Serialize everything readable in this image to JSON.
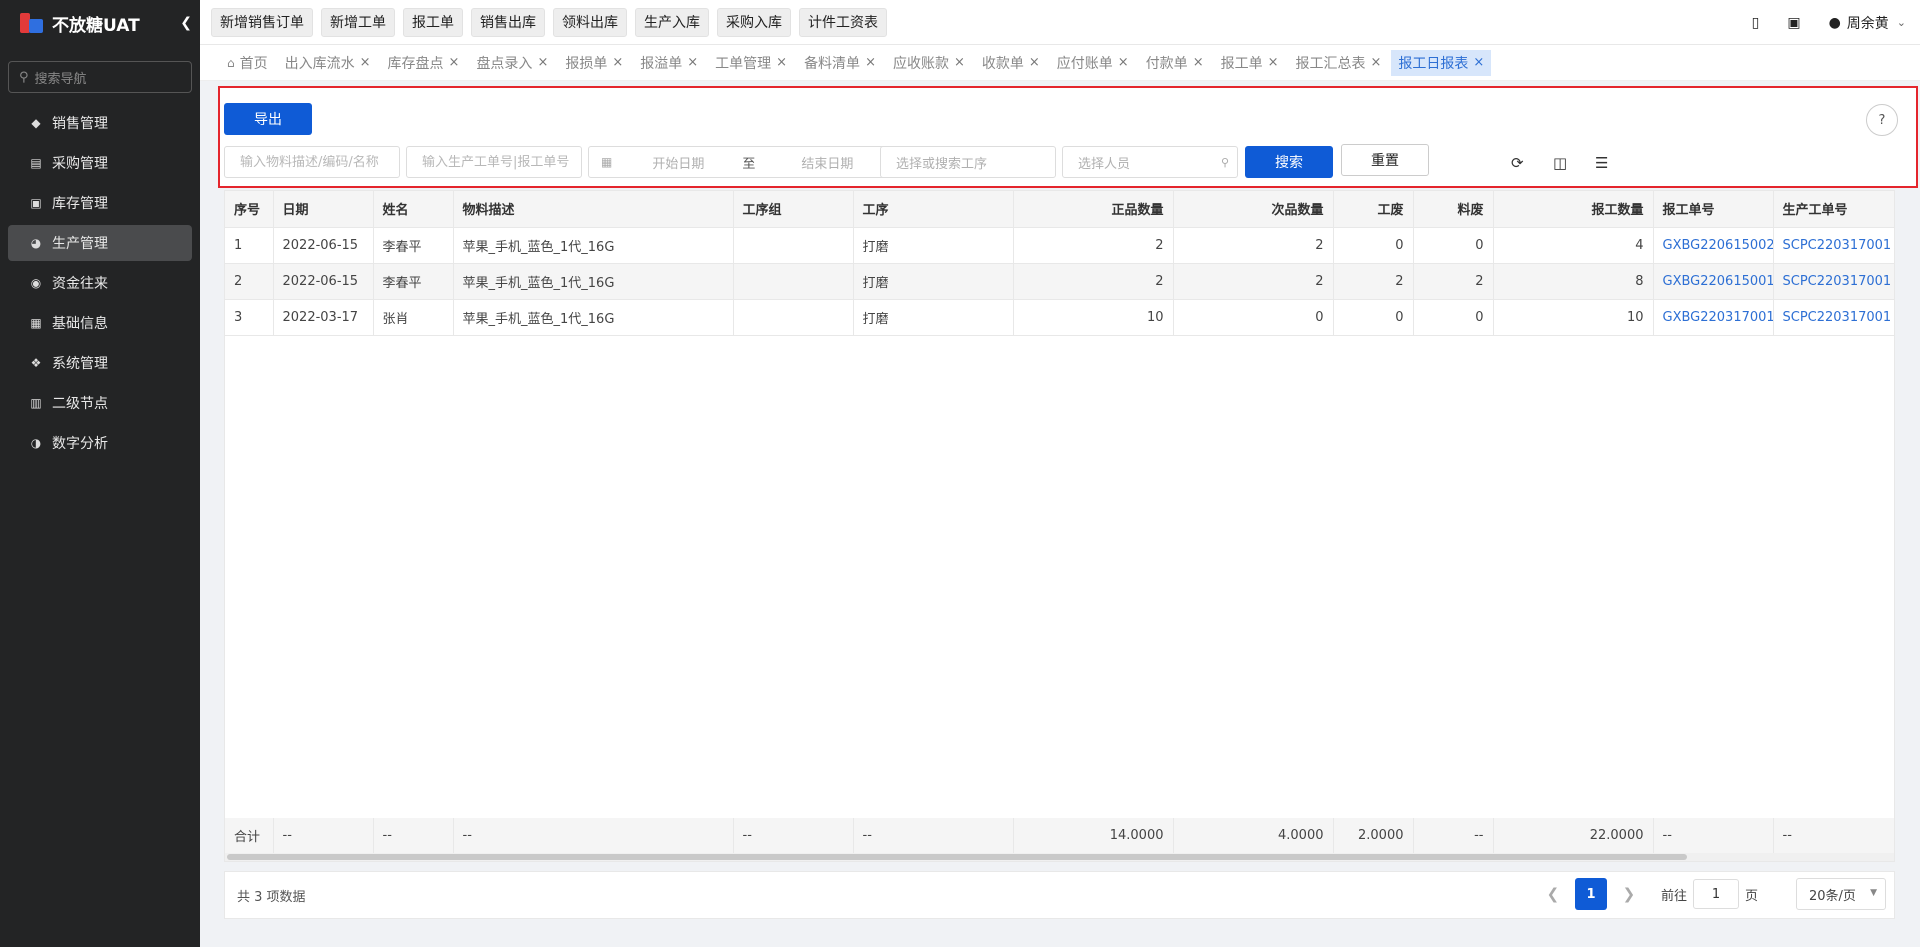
{
  "app": {
    "title": "不放糖UAT",
    "collapse_icon": "chevron-left-icon"
  },
  "sidebar": {
    "search_placeholder": "搜索导航",
    "items": [
      {
        "label": "销售管理",
        "icon": "tag-icon",
        "active": false
      },
      {
        "label": "采购管理",
        "icon": "cart-icon",
        "active": false
      },
      {
        "label": "库存管理",
        "icon": "warehouse-icon",
        "active": false
      },
      {
        "label": "生产管理",
        "icon": "production-icon",
        "active": true
      },
      {
        "label": "资金往来",
        "icon": "money-icon",
        "active": false
      },
      {
        "label": "基础信息",
        "icon": "info-grid-icon",
        "active": false
      },
      {
        "label": "系统管理",
        "icon": "apps-icon",
        "active": false
      },
      {
        "label": "二级节点",
        "icon": "document-icon",
        "active": false
      },
      {
        "label": "数字分析",
        "icon": "pie-chart-icon",
        "active": false
      }
    ]
  },
  "toolbar": {
    "quick_buttons": [
      "新增销售订单",
      "新增工单",
      "报工单",
      "销售出库",
      "领料出库",
      "生产入库",
      "采购入库",
      "计件工资表"
    ],
    "user_name": "周余黄"
  },
  "tabs": [
    {
      "label": "首页",
      "home": true,
      "active": false
    },
    {
      "label": "出入库流水",
      "active": false
    },
    {
      "label": "库存盘点",
      "active": false
    },
    {
      "label": "盘点录入",
      "active": false
    },
    {
      "label": "报损单",
      "active": false
    },
    {
      "label": "报溢单",
      "active": false
    },
    {
      "label": "工单管理",
      "active": false
    },
    {
      "label": "备料清单",
      "active": false
    },
    {
      "label": "应收账款",
      "active": false
    },
    {
      "label": "收款单",
      "active": false
    },
    {
      "label": "应付账单",
      "active": false
    },
    {
      "label": "付款单",
      "active": false
    },
    {
      "label": "报工单",
      "active": false
    },
    {
      "label": "报工汇总表",
      "active": false
    },
    {
      "label": "报工日报表",
      "active": true
    }
  ],
  "filter": {
    "export_label": "导出",
    "material_placeholder": "输入物料描述/编码/名称",
    "order_placeholder": "输入生产工单号|报工单号",
    "start_date_placeholder": "开始日期",
    "date_separator": "至",
    "end_date_placeholder": "结束日期",
    "process_placeholder": "选择或搜索工序",
    "person_placeholder": "选择人员",
    "search_label": "搜索",
    "reset_label": "重置"
  },
  "table": {
    "columns": [
      "序号",
      "日期",
      "姓名",
      "物料描述",
      "工序组",
      "工序",
      "正品数量",
      "次品数量",
      "工废",
      "料废",
      "报工数量",
      "报工单号",
      "生产工单号"
    ],
    "rows": [
      [
        "1",
        "2022-06-15",
        "李春平",
        "苹果_手机_蓝色_1代_16G",
        "",
        "打磨",
        "2",
        "2",
        "0",
        "0",
        "4",
        "GXBG220615002",
        "SCPC220317001"
      ],
      [
        "2",
        "2022-06-15",
        "李春平",
        "苹果_手机_蓝色_1代_16G",
        "",
        "打磨",
        "2",
        "2",
        "2",
        "2",
        "8",
        "GXBG220615001",
        "SCPC220317001"
      ],
      [
        "3",
        "2022-03-17",
        "张肖",
        "苹果_手机_蓝色_1代_16G",
        "",
        "打磨",
        "10",
        "0",
        "0",
        "0",
        "10",
        "GXBG220317001",
        "SCPC220317001"
      ]
    ],
    "summary": [
      "合计",
      "--",
      "--",
      "--",
      "--",
      "--",
      "14.0000",
      "4.0000",
      "2.0000",
      "--",
      "22.0000",
      "--",
      "--"
    ]
  },
  "footer": {
    "total_text": "共 3 项数据",
    "current_page": "1",
    "goto_label": "前往",
    "goto_value": "1",
    "page_unit": "页",
    "page_size": "20条/页"
  },
  "colors": {
    "primary": "#0f5bd6",
    "sidebar_bg": "#232425",
    "highlight_border": "#e4252c",
    "link": "#2d6fd4"
  }
}
